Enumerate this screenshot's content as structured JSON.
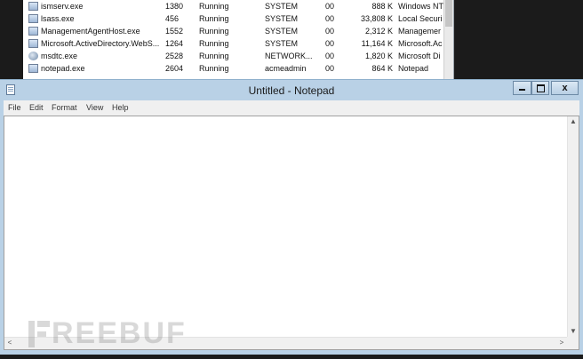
{
  "task_manager": {
    "rows": [
      {
        "icon": "app-icon",
        "name": "ismserv.exe",
        "pid": "1380",
        "status": "Running",
        "user": "SYSTEM",
        "cpu": "00",
        "memory": "888 K",
        "description": "Windows NT"
      },
      {
        "icon": "app-icon",
        "name": "lsass.exe",
        "pid": "456",
        "status": "Running",
        "user": "SYSTEM",
        "cpu": "00",
        "memory": "33,808 K",
        "description": "Local Securi"
      },
      {
        "icon": "app-icon",
        "name": "ManagementAgentHost.exe",
        "pid": "1552",
        "status": "Running",
        "user": "SYSTEM",
        "cpu": "00",
        "memory": "2,312 K",
        "description": "Managemer"
      },
      {
        "icon": "app-icon",
        "name": "Microsoft.ActiveDirectory.WebS...",
        "pid": "1264",
        "status": "Running",
        "user": "SYSTEM",
        "cpu": "00",
        "memory": "11,164 K",
        "description": "Microsoft.Ac"
      },
      {
        "icon": "service-icon",
        "name": "msdtc.exe",
        "pid": "2528",
        "status": "Running",
        "user": "NETWORK...",
        "cpu": "00",
        "memory": "1,820 K",
        "description": "Microsoft Di"
      },
      {
        "icon": "app-icon",
        "name": "notepad.exe",
        "pid": "2604",
        "status": "Running",
        "user": "acmeadmin",
        "cpu": "00",
        "memory": "864 K",
        "description": "Notepad"
      }
    ]
  },
  "notepad": {
    "title": "Untitled - Notepad",
    "controls": {
      "minimize_icon": "minimize-icon",
      "maximize_icon": "maximize-icon",
      "close_label": "x"
    },
    "menu": [
      "File",
      "Edit",
      "Format",
      "View",
      "Help"
    ],
    "content": "",
    "scroll_arrows": {
      "up": "▲",
      "down": "▼",
      "left": "<",
      "right": ">"
    }
  },
  "watermark": {
    "text": "REEBUF"
  }
}
